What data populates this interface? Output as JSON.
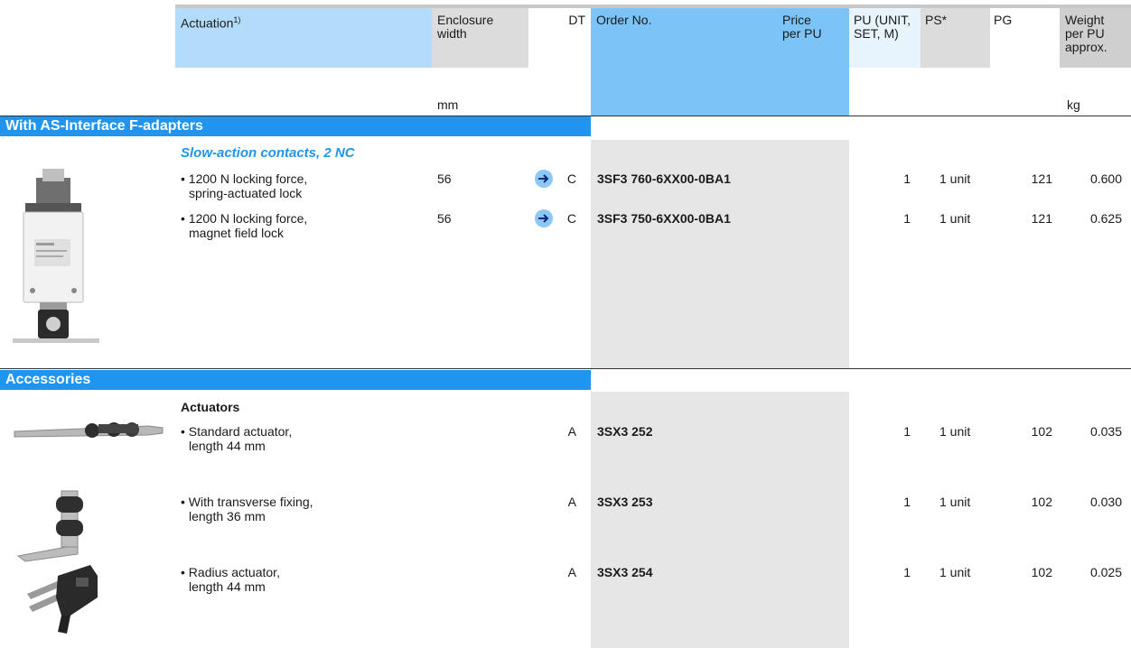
{
  "header": {
    "actuation": "Actuation",
    "actuation_sup": "1)",
    "enclosure_width": "Enclosure width",
    "enclosure_unit": "mm",
    "dt": "DT",
    "order_no": "Order No.",
    "price_per_pu": "Price per PU",
    "pu": "PU (UNIT, SET, M)",
    "ps": "PS*",
    "pg": "PG",
    "weight": "Weight per PU approx.",
    "weight_unit": "kg"
  },
  "sections": {
    "as_interface": "With AS-Interface F-adapters",
    "accessories": "Accessories"
  },
  "group1": {
    "subheading": "Slow-action contacts, 2 NC",
    "rows": [
      {
        "actuation_line1": "• 1200 N locking force,",
        "actuation_line2": "spring-actuated lock",
        "width": "56",
        "dt": "C",
        "order_no": "3SF3 760-6XX00-0BA1",
        "pu": "1",
        "ps": "1 unit",
        "pg": "121",
        "weight": "0.600"
      },
      {
        "actuation_line1": "• 1200 N locking force,",
        "actuation_line2": "magnet field lock",
        "width": "56",
        "dt": "C",
        "order_no": "3SF3 750-6XX00-0BA1",
        "pu": "1",
        "ps": "1 unit",
        "pg": "121",
        "weight": "0.625"
      }
    ]
  },
  "group2": {
    "subheading": "Actuators",
    "rows": [
      {
        "actuation_line1": "• Standard actuator,",
        "actuation_line2": "length 44 mm",
        "dt": "A",
        "order_no": "3SX3 252",
        "pu": "1",
        "ps": "1 unit",
        "pg": "102",
        "weight": "0.035"
      },
      {
        "actuation_line1": "• With transverse fixing,",
        "actuation_line2": "length 36 mm",
        "dt": "A",
        "order_no": "3SX3 253",
        "pu": "1",
        "ps": "1 unit",
        "pg": "102",
        "weight": "0.030"
      },
      {
        "actuation_line1": "• Radius actuator,",
        "actuation_line2": "length 44 mm",
        "dt": "A",
        "order_no": "3SX3 254",
        "pu": "1",
        "ps": "1 unit",
        "pg": "102",
        "weight": "0.025"
      }
    ]
  },
  "colors": {
    "section_blue": "#1f95f0",
    "header_light_blue": "#b3dcfa",
    "order_col_blue": "#7cc4f8",
    "grey_header": "#dcdcdc",
    "grey_column": "#e6e6e6"
  }
}
